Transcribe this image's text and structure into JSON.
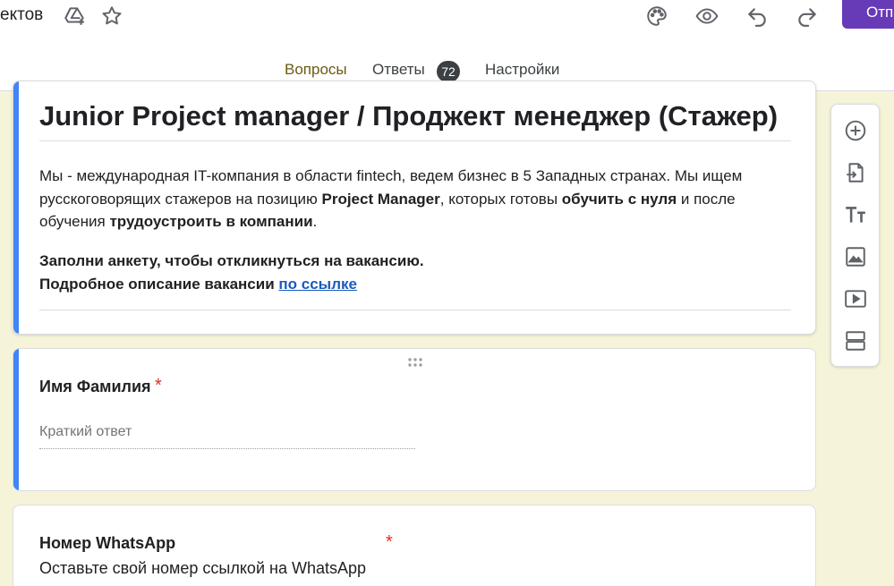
{
  "header": {
    "doc_name_fragment": "ектов",
    "send_label": "Отп",
    "icons": [
      "drive-add-icon",
      "star-icon",
      "palette-icon",
      "eye-icon",
      "undo-icon",
      "redo-icon"
    ]
  },
  "tabs": [
    {
      "label": "Вопросы",
      "active": true
    },
    {
      "label": "Ответы",
      "badge": "72"
    },
    {
      "label": "Настройки"
    }
  ],
  "form": {
    "title": "Junior Project manager / Проджект менеджер (Стажер)",
    "desc": {
      "p1": "Мы - международная IT-компания в области fintech, ведем бизнес в 5 Западных странах. Мы ищем русскоговорящих стажеров на позицию ",
      "b1": "Project Manager",
      "p2": ", которых готовы ",
      "b2": "обучить с нуля",
      "p3": " и после обучения ",
      "b3": "трудоустроить в компании",
      "p4": "."
    },
    "cta_line1": "Заполни анкету, чтобы откликнуться на вакансию.",
    "cta_line2_prefix": "Подробное описание вакансии ",
    "cta_link": "по ссылке"
  },
  "questions": [
    {
      "title": "Имя Фамилия",
      "required_mark": "*",
      "placeholder": "Краткий ответ"
    },
    {
      "title": "Номер WhatsApp",
      "required_mark": "*",
      "description": "Оставьте свой номер ссылкой на WhatsApp"
    }
  ],
  "toolbar": {
    "tools": [
      "add-question-icon",
      "import-questions-icon",
      "add-title-icon",
      "add-image-icon",
      "add-video-icon",
      "add-section-icon"
    ]
  },
  "colors": {
    "accent": "#673ab7",
    "active_tab": "#6b5a12",
    "background": "#f6f4d8",
    "active_card_bar": "#4285f4",
    "required": "#d93025",
    "link": "#1a5bbf"
  }
}
